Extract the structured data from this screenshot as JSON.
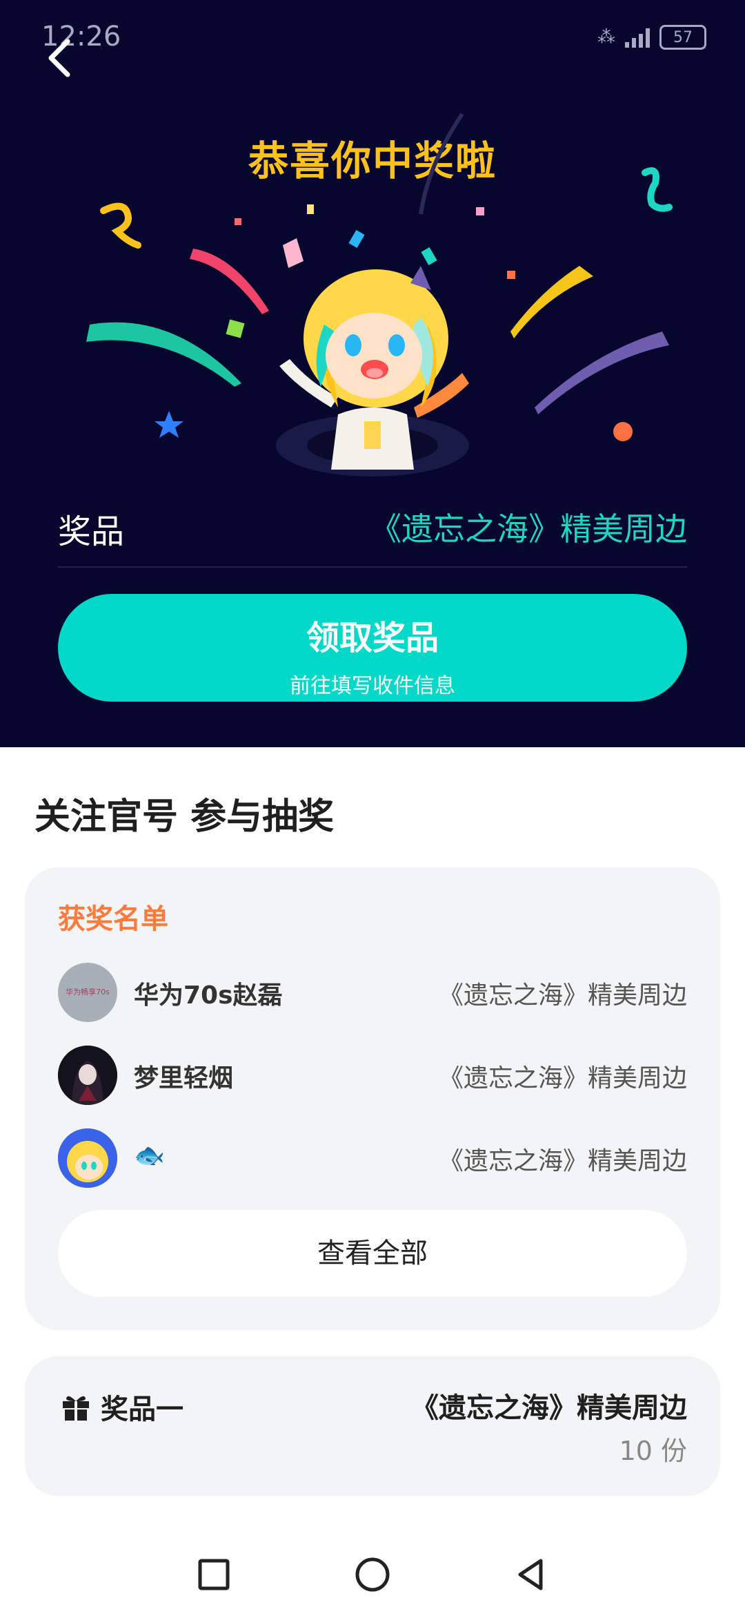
{
  "status": {
    "time": "12:26",
    "battery": "57"
  },
  "hero": {
    "title": "恭喜你中奖啦",
    "prize_label": "奖品",
    "prize_value": "《遗忘之海》精美周边",
    "claim_button": "领取奖品",
    "claim_sub": "前往填写收件信息"
  },
  "section": {
    "title": "关注官号 参与抽奖"
  },
  "winners": {
    "header": "获奖名单",
    "items": [
      {
        "name": "华为70s赵磊",
        "prize": "《遗忘之海》精美周边",
        "avatar_text": "华为畅享70s"
      },
      {
        "name": "梦里轻烟",
        "prize": "《遗忘之海》精美周边"
      },
      {
        "name": "🐟",
        "prize": "《遗忘之海》精美周边"
      }
    ],
    "view_all": "查看全部"
  },
  "award": {
    "label": "奖品一",
    "prize": "《遗忘之海》精美周边",
    "count": "10 份"
  },
  "colors": {
    "hero_bg": "#07072e",
    "title": "#ffc21a",
    "accent": "#00d9c8",
    "winners_header": "#ff7a3d"
  },
  "icons": [
    "back-icon",
    "gift-icon",
    "nav-recents-icon",
    "nav-home-icon",
    "nav-back-icon"
  ]
}
